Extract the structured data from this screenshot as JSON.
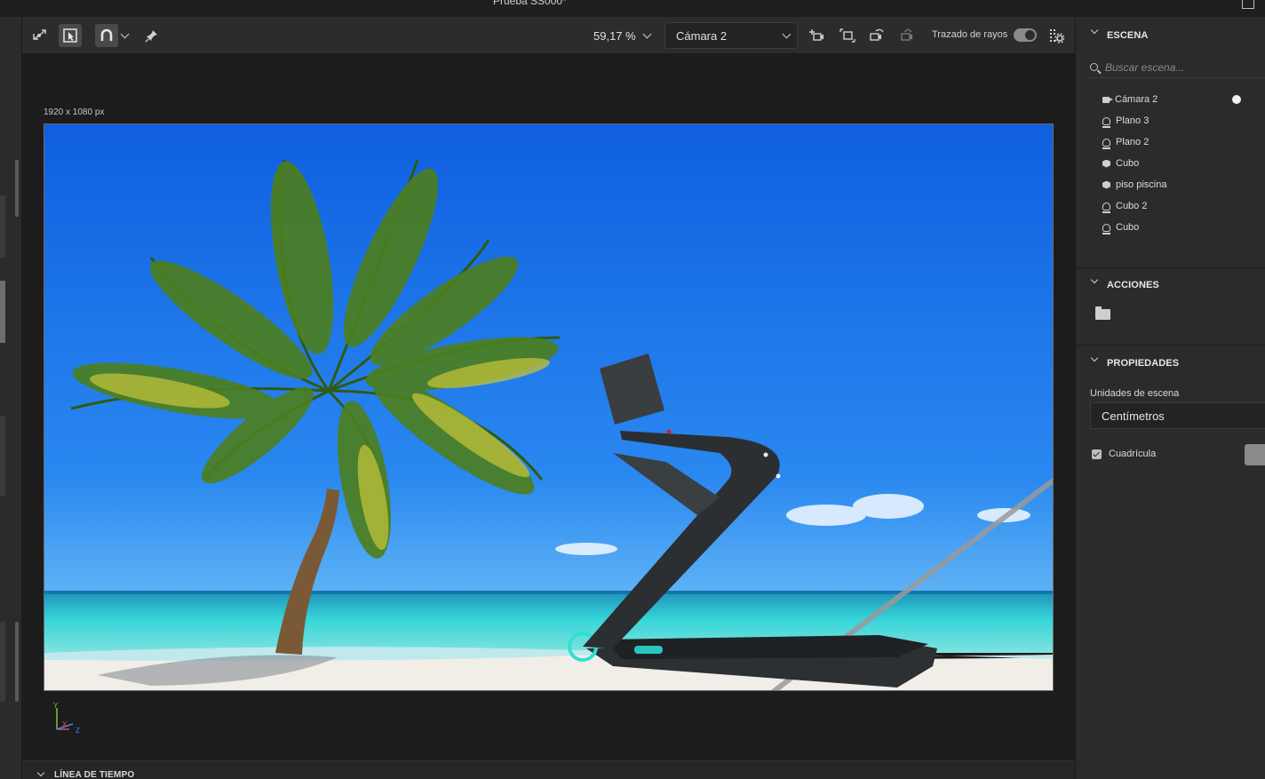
{
  "window": {
    "title": "Prueba SS000*"
  },
  "toolbar": {
    "icons": [
      "orbit-icon",
      "select-frame-icon",
      "magnet-icon",
      "magnet-dropdown-icon",
      "pin-icon",
      "camera-add-icon",
      "frame-icon",
      "camera-rotate-icon",
      "camera-disabled-icon",
      "render-settings-icon"
    ],
    "zoom_value": "59,17 %",
    "camera_value": "Cámara 2",
    "raytrace_label": "Trazado de rayos",
    "raytrace_on": true
  },
  "viewport": {
    "dims_label": "1920 x 1080 px",
    "axis": {
      "y": "Y",
      "x": "X",
      "z": "Z"
    }
  },
  "timeline": {
    "label": "LÍNEA DE TIEMPO"
  },
  "scene": {
    "title": "ESCENA",
    "search_placeholder": "Buscar escena...",
    "items": [
      {
        "label": "Cámara 2",
        "icon": "camera-icon",
        "active": true
      },
      {
        "label": "Plano 3",
        "icon": "plane-icon"
      },
      {
        "label": "Plano 2",
        "icon": "plane-icon"
      },
      {
        "label": "Cubo",
        "icon": "cube-icon"
      },
      {
        "label": "piso piscina",
        "icon": "cube-icon"
      },
      {
        "label": "Cubo 2",
        "icon": "plane-icon"
      },
      {
        "label": "Cubo",
        "icon": "plane-icon"
      }
    ]
  },
  "actions": {
    "title": "ACCIONES",
    "icon": "folder-icon"
  },
  "properties": {
    "title": "PROPIEDADES",
    "units_label": "Unidades de escena",
    "units_value": "Centímetros",
    "grid_label": "Cuadrícula",
    "grid_checked": true,
    "grid_color": "#8a8a8a"
  },
  "colors": {
    "sky": "#1766e0",
    "sea": "#2ec7d0",
    "sand": "#f2efe9",
    "panel": "#2b2b2b"
  }
}
